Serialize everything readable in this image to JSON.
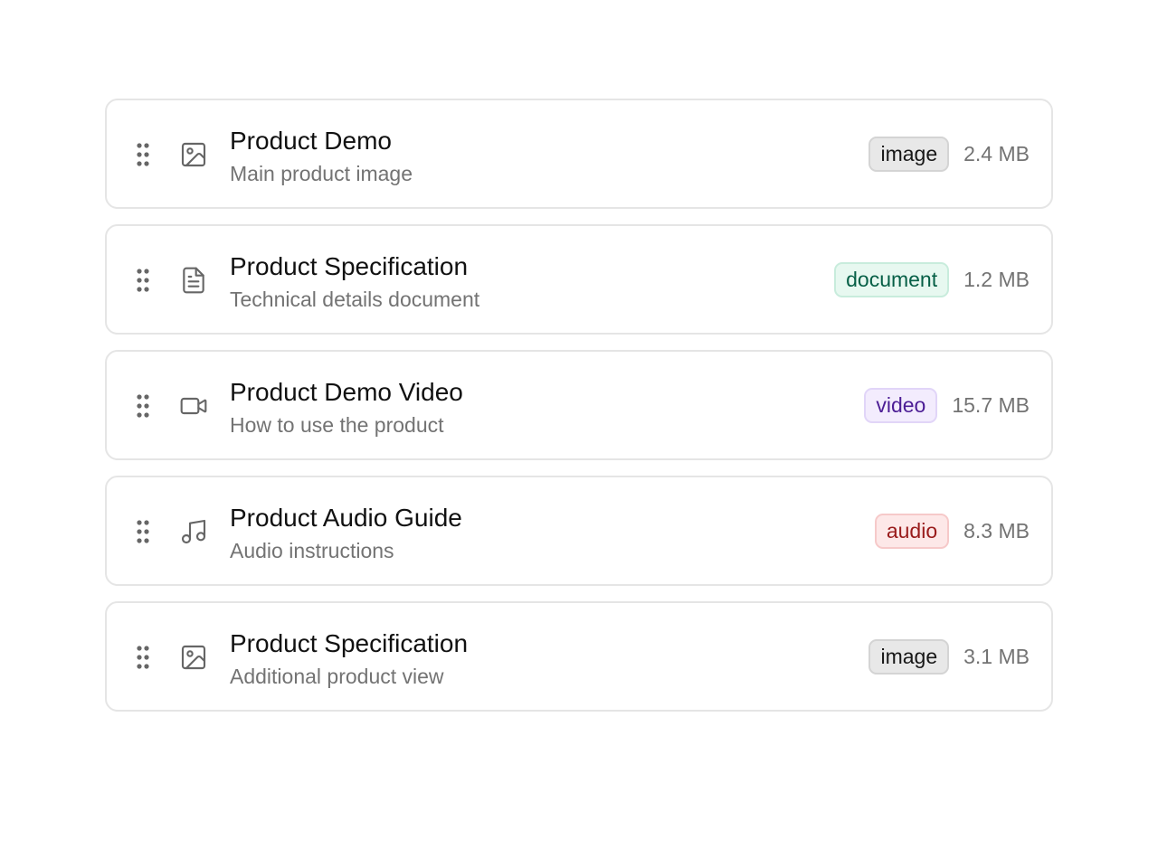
{
  "files": [
    {
      "title": "Product Demo",
      "description": "Main product image",
      "type": "image",
      "size": "2.4 MB",
      "icon": "image-icon"
    },
    {
      "title": "Product Specification",
      "description": "Technical details document",
      "type": "document",
      "size": "1.2 MB",
      "icon": "document-icon"
    },
    {
      "title": "Product Demo Video",
      "description": "How to use the product",
      "type": "video",
      "size": "15.7 MB",
      "icon": "video-icon"
    },
    {
      "title": "Product Audio Guide",
      "description": "Audio instructions",
      "type": "audio",
      "size": "8.3 MB",
      "icon": "music-icon"
    },
    {
      "title": "Product Specification",
      "description": "Additional product view",
      "type": "image",
      "size": "3.1 MB",
      "icon": "image-icon"
    }
  ],
  "colors": {
    "icon": "#666666",
    "border": "#e5e5e5",
    "muted_text": "#737373"
  }
}
